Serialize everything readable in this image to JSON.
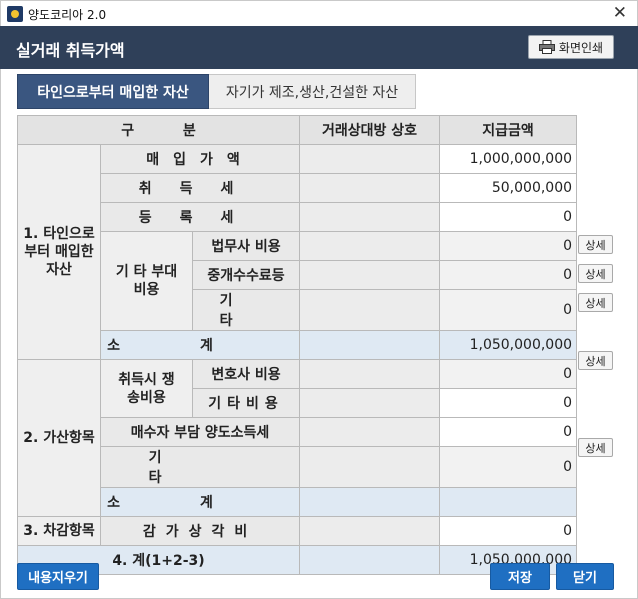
{
  "window": {
    "title": "양도코리아 2.0",
    "close_glyph": "✕"
  },
  "header": {
    "title": "실거래 취득가액",
    "print_label": "화면인쇄"
  },
  "tabs": [
    {
      "label": "타인으로부터 매입한 자산",
      "active": true
    },
    {
      "label": "자기가 제조,생산,건설한 자산",
      "active": false
    }
  ],
  "table": {
    "headers": {
      "category": "구          분",
      "counterparty": "거래상대방 상호",
      "amount": "지급금액"
    },
    "group1": {
      "label": "1. 타인으로 부터 매입한 자산",
      "rows": {
        "purchase": {
          "label": "매입가액",
          "amount": "1,000,000,000"
        },
        "acquisition_tax": {
          "label": "취득세",
          "amount": "50,000,000"
        },
        "registration_tax": {
          "label": "등록세",
          "amount": "0"
        }
      },
      "other_costs": {
        "label": "기 타 부대비용",
        "rows": {
          "legal": {
            "label": "법무사 비용",
            "amount": "0",
            "detail": "상세"
          },
          "broker": {
            "label": "중개수수료등",
            "amount": "0",
            "detail": "상세"
          },
          "misc": {
            "label": "기타",
            "amount": "0",
            "detail": "상세"
          }
        }
      },
      "subtotal": {
        "label": "소계",
        "amount": "1,050,000,000"
      }
    },
    "group2": {
      "label": "2. 가산항목",
      "litigation": {
        "label": "취득시 쟁송비용",
        "rows": {
          "lawyer": {
            "label": "변호사 비용",
            "amount": "0",
            "detail": "상세"
          },
          "other": {
            "label": "기타비용",
            "amount": "0"
          }
        }
      },
      "buyer_tax": {
        "label": "매수자 부담 양도소득세",
        "amount": "0"
      },
      "misc": {
        "label": "기타",
        "amount": "0",
        "detail": "상세"
      },
      "subtotal": {
        "label": "소계",
        "amount": ""
      }
    },
    "group3": {
      "label": "3. 차감항목",
      "depreciation": {
        "label": "감가상각비",
        "amount": "0"
      }
    },
    "total": {
      "label": "4. 계(1+2-3)",
      "amount": "1,050,000,000"
    }
  },
  "footer": {
    "clear_label": "내용지우기",
    "save_label": "저장",
    "close_label": "닫기"
  },
  "colors": {
    "header_bg": "#2f4059",
    "tab_active": "#3a5680",
    "button_blue": "#1f6fc2",
    "subtotal_bg": "#dfe9f3"
  },
  "icons": [
    "app-icon",
    "close-icon",
    "printer-icon"
  ]
}
